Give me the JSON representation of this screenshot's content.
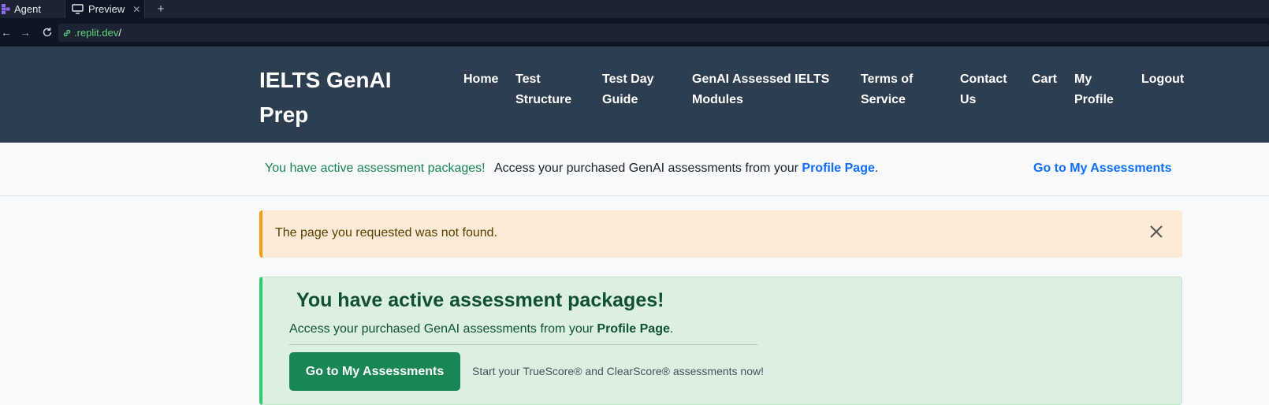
{
  "browser": {
    "tabs": [
      {
        "label": "Agent"
      },
      {
        "label": "Preview"
      }
    ],
    "new_tab": "+",
    "url": ".replit.dev",
    "url_suffix": "/"
  },
  "site": {
    "brand_line1": "IELTS GenAI",
    "brand_line2": "Prep",
    "nav": {
      "home": [
        "Home"
      ],
      "test_structure": [
        "Test",
        "Structure"
      ],
      "test_day_guide": [
        "Test Day",
        "Guide"
      ],
      "modules": [
        "GenAI Assessed IELTS",
        "Modules"
      ],
      "terms": [
        "Terms of",
        "Service"
      ],
      "contact": [
        "Contact",
        "Us"
      ],
      "cart": [
        "Cart"
      ],
      "profile": [
        "My",
        "Profile"
      ],
      "logout": [
        "Logout"
      ]
    }
  },
  "info_banner": {
    "status": "You have active assessment packages!",
    "message": "Access your purchased GenAI assessments from your",
    "profile_link": "Profile Page",
    "period": ".",
    "cta": "Go to My Assessments"
  },
  "alert": {
    "message": "The page you requested was not found."
  },
  "card": {
    "title": "You have active assessment packages!",
    "text": "Access your purchased GenAI assessments from your",
    "profile_link": "Profile Page",
    "period": ".",
    "button": "Go to My Assessments",
    "note": "Start your TrueScore® and ClearScore® assessments now!"
  },
  "colors": {
    "navbar_bg": "#2c3e50",
    "alert_warning_border": "#f39c12",
    "success_border": "#2ecc71",
    "button_bg": "#198754",
    "link": "#0d6efd"
  }
}
